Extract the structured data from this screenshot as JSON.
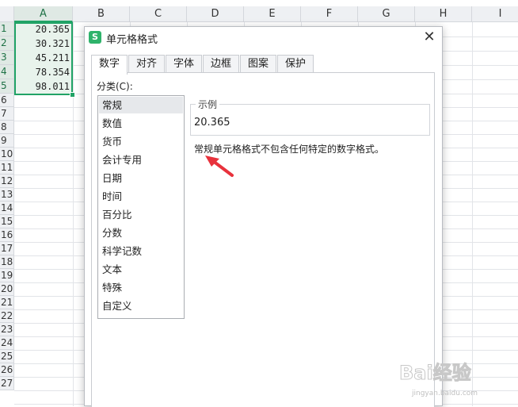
{
  "spreadsheet": {
    "columns": [
      "A",
      "B",
      "C",
      "D",
      "E",
      "F",
      "G",
      "H",
      "I"
    ],
    "rows": [
      "1",
      "2",
      "3",
      "4",
      "5",
      "6",
      "7",
      "8",
      "9",
      "10",
      "11",
      "12",
      "13",
      "14",
      "15",
      "16",
      "17",
      "18",
      "19",
      "20",
      "21",
      "22",
      "23",
      "24",
      "25",
      "26",
      "27"
    ],
    "active_column": "A",
    "cells": [
      "20.365",
      "30.321",
      "45.211",
      "78.354",
      "98.011"
    ]
  },
  "dialog": {
    "title": "单元格格式",
    "app_icon_text": "S",
    "close_symbol": "✕",
    "tabs": [
      "数字",
      "对齐",
      "字体",
      "边框",
      "图案",
      "保护"
    ],
    "active_tab": "数字",
    "category_label": "分类(C):",
    "categories": [
      "常规",
      "数值",
      "货币",
      "会计专用",
      "日期",
      "时间",
      "百分比",
      "分数",
      "科学记数",
      "文本",
      "特殊",
      "自定义"
    ],
    "selected_category": "常规",
    "sample_label": "示例",
    "sample_value": "20.365",
    "description": "常规单元格格式不包含任何特定的数字格式。"
  },
  "annotation": {
    "arrow_color": "#e8323c"
  },
  "watermark": {
    "text": "Bai经验",
    "sub": "jingyan.baidu.com"
  },
  "colors": {
    "accent": "#21a366",
    "header_bg": "#eef0f3"
  }
}
